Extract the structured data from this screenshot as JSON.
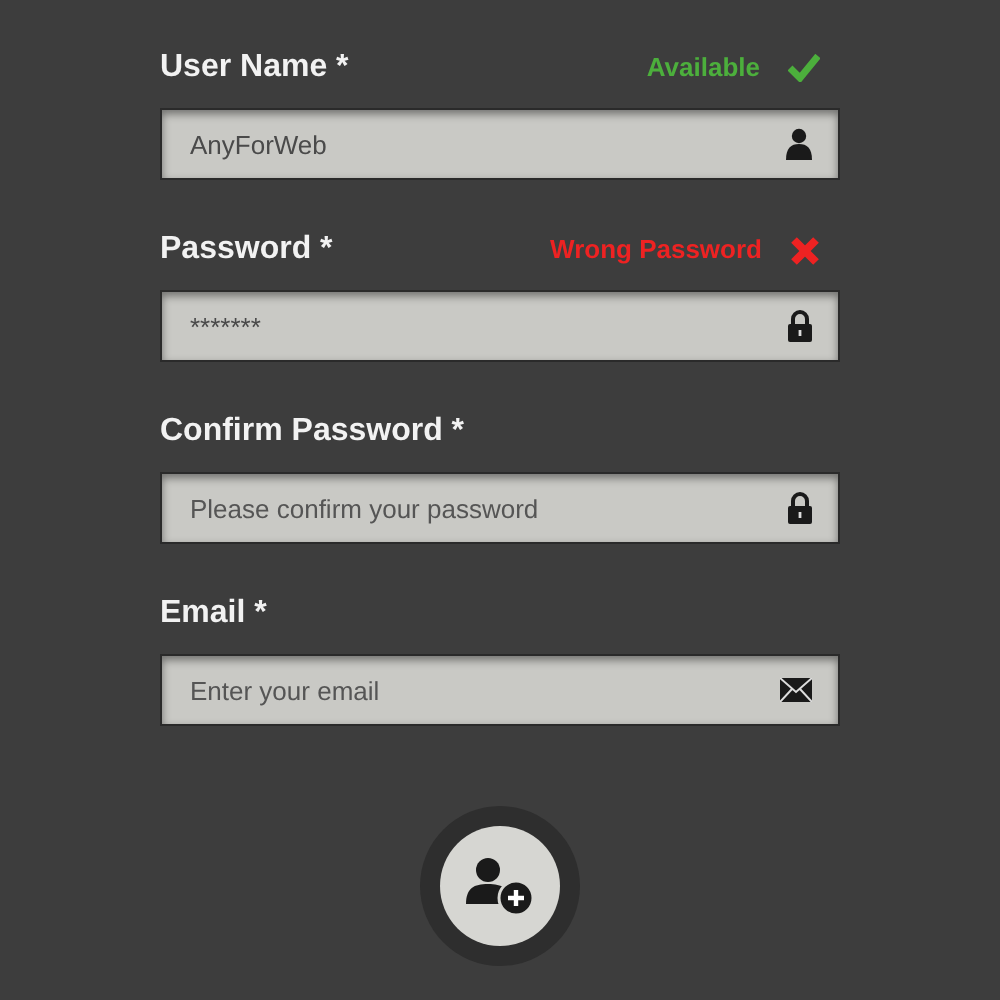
{
  "fields": [
    {
      "label": "User Name *",
      "value": "AnyForWeb",
      "kind": "user",
      "status": {
        "kind": "ok",
        "text": "Available"
      }
    },
    {
      "label": "Password *",
      "value": "*******",
      "kind": "password",
      "status": {
        "kind": "error",
        "text": "Wrong Password"
      }
    },
    {
      "label": "Confirm Password *",
      "placeholder": "Please confirm your password",
      "kind": "password"
    },
    {
      "label": "Email *",
      "placeholder": "Enter your email",
      "kind": "email"
    }
  ]
}
